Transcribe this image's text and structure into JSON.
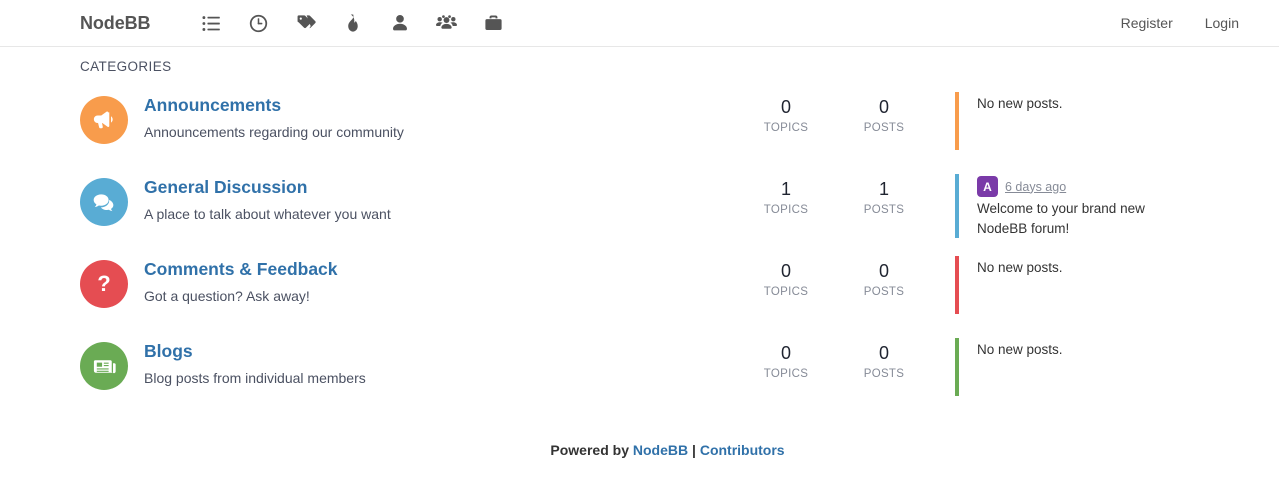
{
  "navbar": {
    "brand": "NodeBB",
    "icons": [
      {
        "name": "list-icon"
      },
      {
        "name": "clock-icon"
      },
      {
        "name": "tags-icon"
      },
      {
        "name": "fire-icon"
      },
      {
        "name": "user-icon"
      },
      {
        "name": "users-icon"
      },
      {
        "name": "briefcase-icon"
      }
    ],
    "register_label": "Register",
    "login_label": "Login"
  },
  "main": {
    "section_title": "CATEGORIES",
    "topics_label": "TOPICS",
    "posts_label": "POSTS",
    "no_new_posts": "No new posts.",
    "categories": [
      {
        "title": "Announcements",
        "description": "Announcements regarding our community",
        "topics": "0",
        "posts": "0",
        "color": "#f89c4c",
        "icon": "bullhorn-icon",
        "recent": {
          "empty": "No new posts."
        }
      },
      {
        "title": "General Discussion",
        "description": "A place to talk about whatever you want",
        "topics": "1",
        "posts": "1",
        "color": "#59acd4",
        "icon": "comments-icon",
        "recent": {
          "avatar_initial": "A",
          "avatar_color": "#7a3aa8",
          "timestamp": "6 days ago",
          "text": "Welcome to your brand new NodeBB forum!"
        }
      },
      {
        "title": "Comments & Feedback",
        "description": "Got a question? Ask away!",
        "topics": "0",
        "posts": "0",
        "color": "#e54d52",
        "icon": "question-icon",
        "recent": {
          "empty": "No new posts."
        }
      },
      {
        "title": "Blogs",
        "description": "Blog posts from individual members",
        "topics": "0",
        "posts": "0",
        "color": "#6aab54",
        "icon": "newspaper-icon",
        "recent": {
          "empty": "No new posts."
        }
      }
    ]
  },
  "footer": {
    "powered_by": "Powered by",
    "nodebb_link": "NodeBB",
    "separator": "|",
    "contributors_link": "Contributors"
  }
}
